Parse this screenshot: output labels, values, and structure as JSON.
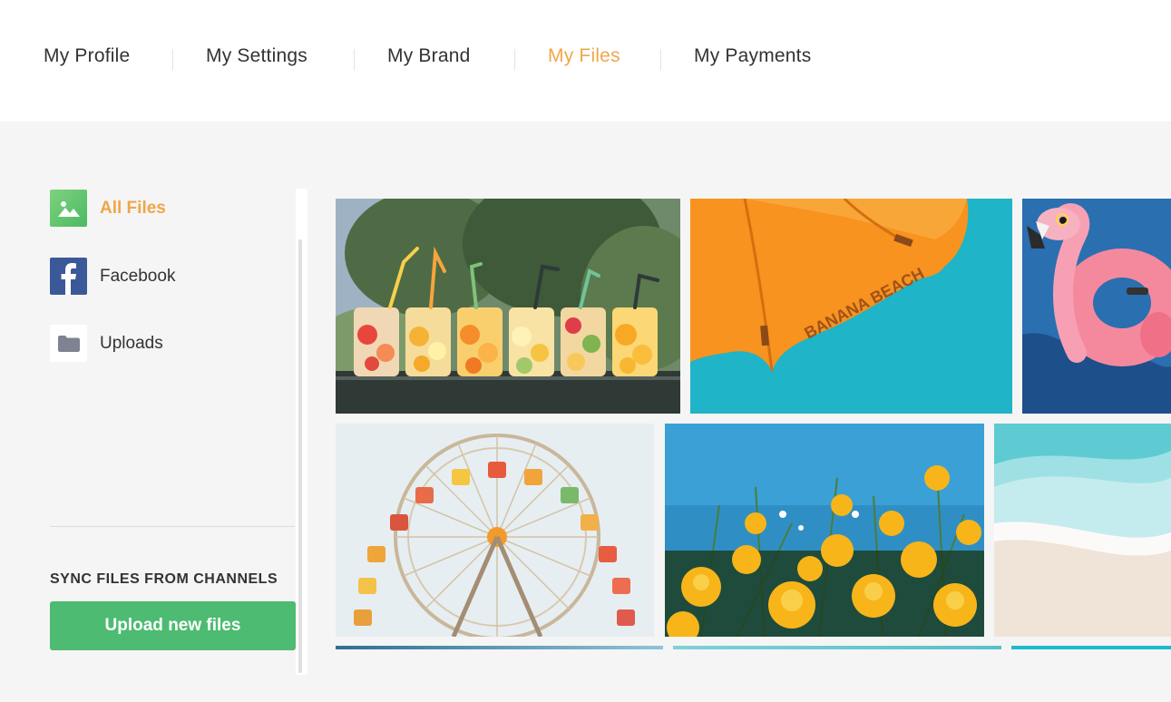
{
  "nav": {
    "items": [
      {
        "label": "My Profile",
        "active": false
      },
      {
        "label": "My Settings",
        "active": false
      },
      {
        "label": "My Brand",
        "active": false
      },
      {
        "label": "My Files",
        "active": true
      },
      {
        "label": "My Payments",
        "active": false
      }
    ]
  },
  "sidebar": {
    "items": [
      {
        "label": "All Files",
        "icon": "image-icon",
        "active": true
      },
      {
        "label": "Facebook",
        "icon": "facebook-icon",
        "active": false
      },
      {
        "label": "Uploads",
        "icon": "folder-icon",
        "active": false
      }
    ],
    "sync_title": "SYNC FILES FROM CHANNELS",
    "upload_button": "Upload new files"
  },
  "gallery": {
    "photos": [
      {
        "subject": "fruit-drinks-in-jars"
      },
      {
        "subject": "orange-beach-umbrella",
        "caption": "BANANA BEACH"
      },
      {
        "subject": "pink-flamingo-float"
      },
      {
        "subject": "ferris-wheel"
      },
      {
        "subject": "yellow-poppies"
      },
      {
        "subject": "beach-waves"
      }
    ]
  },
  "colors": {
    "accent": "#f0a64a",
    "text": "#333333",
    "upload_button": "#4dbb72",
    "facebook": "#3b5998"
  }
}
